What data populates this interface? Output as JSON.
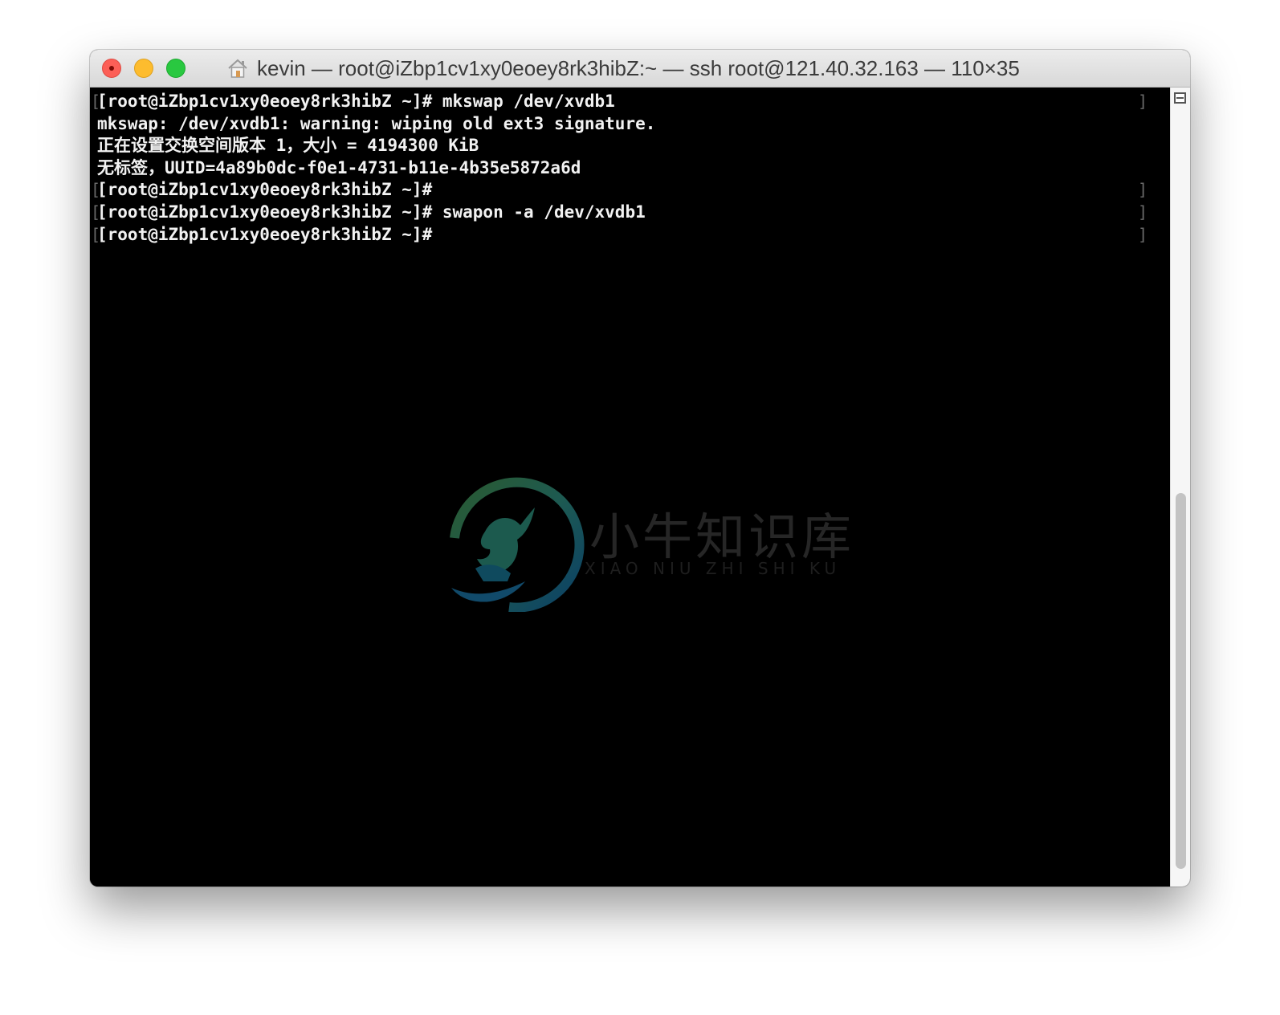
{
  "window": {
    "title": "kevin — root@iZbp1cv1xy0eoey8rk3hibZ:~ — ssh root@121.40.32.163 — 110×35"
  },
  "terminal": {
    "lines": [
      {
        "text": "[root@iZbp1cv1xy0eoey8rk3hibZ ~]# mkswap /dev/xvdb1",
        "marked": true
      },
      {
        "text": "mkswap: /dev/xvdb1: warning: wiping old ext3 signature.",
        "marked": false
      },
      {
        "text": "正在设置交换空间版本 1，大小 = 4194300 KiB",
        "marked": false
      },
      {
        "text": "无标签，UUID=4a89b0dc-f0e1-4731-b11e-4b35e5872a6d",
        "marked": false
      },
      {
        "text": "[root@iZbp1cv1xy0eoey8rk3hibZ ~]#",
        "marked": true
      },
      {
        "text": "[root@iZbp1cv1xy0eoey8rk3hibZ ~]# swapon -a /dev/xvdb1",
        "marked": true
      },
      {
        "text": "[root@iZbp1cv1xy0eoey8rk3hibZ ~]#",
        "marked": true
      }
    ]
  },
  "watermark": {
    "title": "小牛知识库",
    "subtitle": "XIAO NIU ZHI SHI KU"
  },
  "colors": {
    "background": "#000000",
    "text": "#f2f2f2",
    "close": "#fc5f57",
    "minimize": "#fdbc2e",
    "maximize": "#29c840"
  },
  "icons": [
    "close-icon",
    "minimize-icon",
    "maximize-icon",
    "home-icon",
    "split-pane-icon"
  ]
}
